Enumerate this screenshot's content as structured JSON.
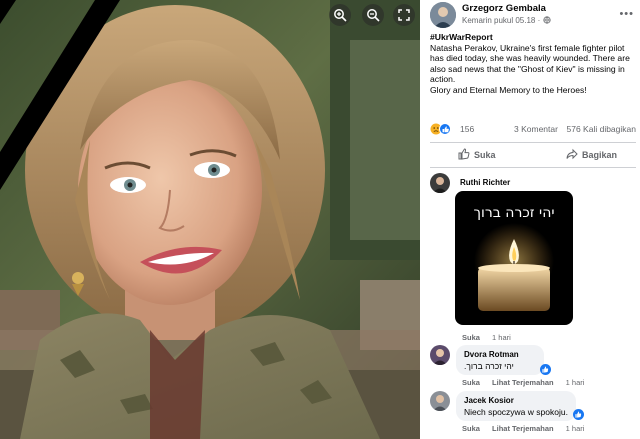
{
  "viewer": {
    "zoom_in_icon": "zoom-in-icon",
    "zoom_out_icon": "zoom-out-icon",
    "fullscreen_icon": "fullscreen-icon"
  },
  "post": {
    "author": "Grzegorz Gembala",
    "timestamp": "Kemarin pukul 05.18",
    "privacy_icon": "globe-icon",
    "more_icon": "more-horizontal-icon",
    "hashtag": "#UkrWarReport",
    "body_lines": [
      "Natasha Perakov, Ukraine's first female fighter pilot",
      "has died today, she was heavily wounded. There are",
      "also sad news that the \"Ghost of Kiev\" is missing in",
      "action.",
      "Glory and Eternal Memory to the Heroes!"
    ],
    "reaction_count": "156",
    "comment_count": "3 Komentar",
    "share_count": "576 Kali dibagikan",
    "like_label": "Suka",
    "share_label": "Bagikan"
  },
  "comments": [
    {
      "name": "Ruthi Richter",
      "image_text": "יהי זכרה ברוך",
      "like_label": "Suka",
      "time": "1 hari"
    },
    {
      "name": "Dvora Rotman",
      "text": "יהי זכרה ברוך.",
      "like_label": "Suka",
      "translate_label": "Lihat Terjemahan",
      "time": "1 hari"
    },
    {
      "name": "Jacek Kosior",
      "text": "Niech spoczywa w spokoju.",
      "like_label": "Suka",
      "translate_label": "Lihat Terjemahan",
      "time": "1 hari"
    }
  ],
  "colors": {
    "facebook_blue": "#1877f2",
    "secondary_text": "#65676b",
    "bubble_bg": "#f0f2f5",
    "divider": "#ced0d4"
  }
}
